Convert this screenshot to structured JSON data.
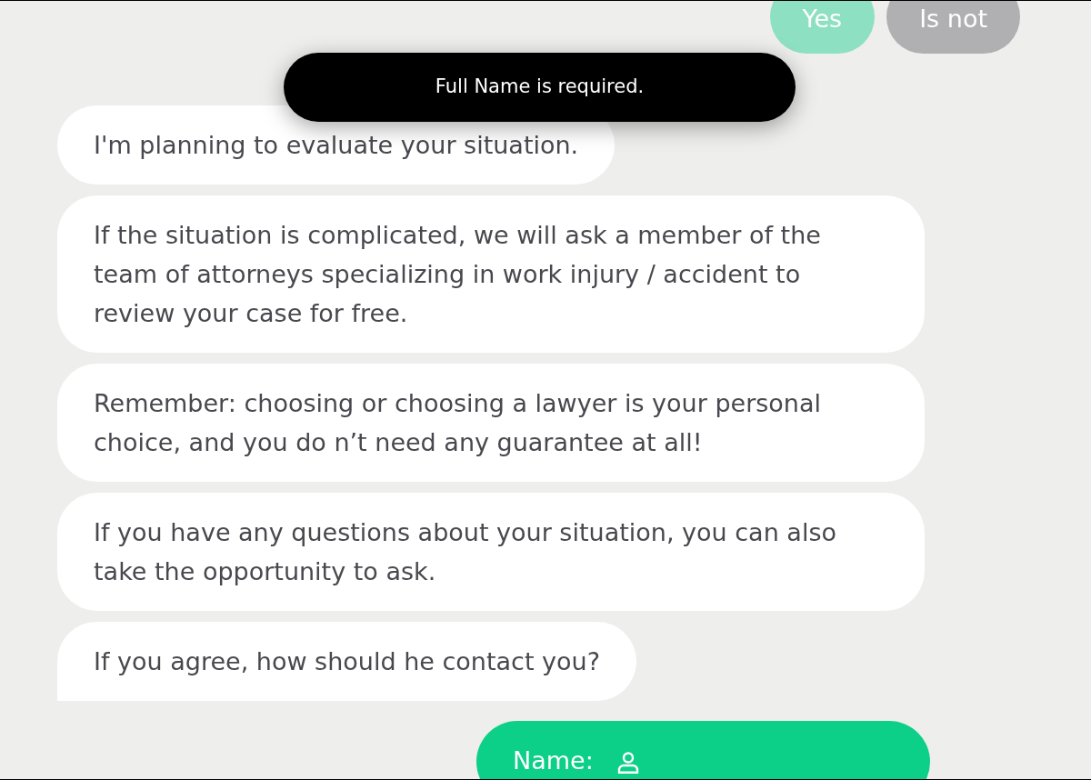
{
  "quick_replies": [
    {
      "label": "Yes",
      "color": "#8ee0c3"
    },
    {
      "label": "Is not",
      "color": "#b0b0b2"
    }
  ],
  "toast": {
    "text": "Full Name is required."
  },
  "messages": [
    {
      "text": "I'm planning to evaluate your situation.",
      "tail": false
    },
    {
      "text": "If the situation is complicated, we will ask a member of the team of attorneys specializing in work injury / accident to review your case for free.",
      "tail": false
    },
    {
      "text": "Remember: choosing or choosing a lawyer is your personal choice, and you do n’t need any guarantee at all!",
      "tail": false
    },
    {
      "text": "If you have any questions about your situation, you can also take the opportunity to ask.",
      "tail": false
    },
    {
      "text": "If you agree, how should he contact you?",
      "tail": true
    }
  ],
  "reply_input": {
    "label": "Name:"
  }
}
